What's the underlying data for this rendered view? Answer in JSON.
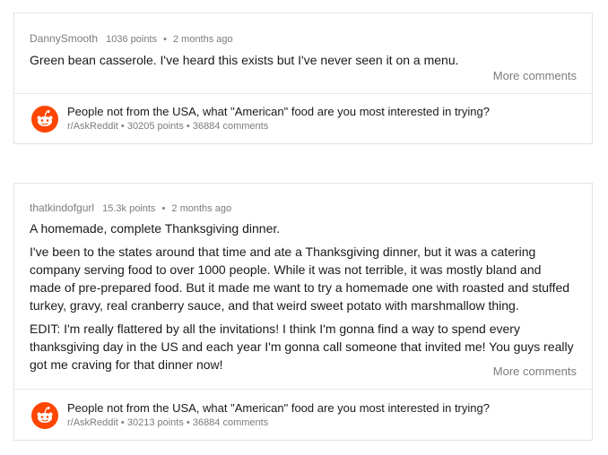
{
  "cards": [
    {
      "author": "DannySmooth",
      "points": "1036 points",
      "age": "2 months ago",
      "paragraphs": [
        "Green bean casserole. I've heard this exists but I've never seen it on a menu."
      ],
      "more_label": "More comments",
      "post": {
        "title": "People not from the USA, what \"American\" food are you most interested in trying?",
        "subreddit": "r/AskReddit",
        "points": "30205 points",
        "comments": "36884 comments"
      }
    },
    {
      "author": "thatkindofgurl",
      "points": "15.3k points",
      "age": "2 months ago",
      "paragraphs": [
        "A homemade, complete Thanksgiving dinner.",
        "I've been to the states around that time and ate a Thanksgiving dinner, but it was a catering company serving food to over 1000 people. While it was not terrible, it was mostly bland and made of pre-prepared food. But it made me want to try a homemade one with roasted and stuffed turkey, gravy, real cranberry sauce, and that weird sweet potato with marshmallow thing.",
        "EDIT: I'm really flattered by all the invitations! I think I'm gonna find a way to spend every thanksgiving day in the US and each year I'm gonna call someone that invited me! You guys really got me craving for that dinner now!"
      ],
      "more_label": "More comments",
      "post": {
        "title": "People not from the USA, what \"American\" food are you most interested in trying?",
        "subreddit": "r/AskReddit",
        "points": "30213 points",
        "comments": "36884 comments"
      }
    }
  ],
  "separator": "•",
  "colors": {
    "reddit_orange": "#ff4500",
    "muted": "#7c7c7c",
    "text": "#1a1a1b"
  },
  "icons": {
    "post_icon": "reddit-snoo-icon"
  }
}
